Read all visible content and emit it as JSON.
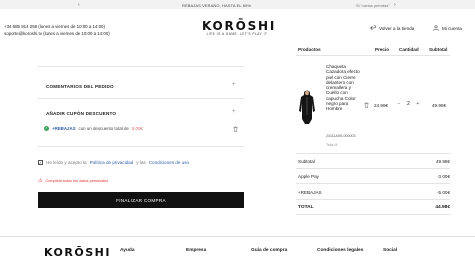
{
  "promo": {
    "prev_glyph": "‹",
    "next_glyph": "›",
    "main_text": "REBAJAS VERANO, HASTA EL 69%",
    "sub_text": "Si \"varias prendas\""
  },
  "header": {
    "phone_line": "+34 685 914 259 (lunes a viernes de 10:00 a 14:00)",
    "email_line": "soporte@koroshi.tv (lunes a viernes de 10:00 a 14:00)",
    "logo_name": "KORŌSHI",
    "logo_tagline": "LIFE IS A GAME. LET'S PLAY IT",
    "back_label": "Volver a la tienda",
    "account_label": "Mi cuenta"
  },
  "form": {
    "comments_label": "COMENTARIOS DEL PEDIDO",
    "coupon_label": "AÑADIR CUPÓN DESCUENTO",
    "coupon_code": "+REBAJAS",
    "coupon_text": "con un descuento total de",
    "coupon_amount": "5.00€",
    "privacy_prefix": "He leído y acepto la",
    "privacy_link": "Política de privacidad",
    "privacy_mid": "y las",
    "terms_link": "Condiciones de uso",
    "warning_text": "Completa todos tus datos personales",
    "submit_label": "FINALIZAR COMPRA"
  },
  "cart": {
    "columns": [
      "Productos",
      "Precio",
      "Cantidad",
      "Subtotal"
    ],
    "item": {
      "description": "Chaqueta Cazadora efecto piel con Cierre delantero con cremallera y Cuello con capucha Color negro para Hombre",
      "sku": "24111A0S-000003",
      "size": "Talla M",
      "price": "24.99€",
      "quantity": "2",
      "qty_minus": "−",
      "qty_plus": "+",
      "subtotal": "49.98€"
    },
    "summary": [
      {
        "label": "Subtotal",
        "value": "49.98€"
      },
      {
        "label": "Apple Pay",
        "value": "0.00€"
      },
      {
        "label": "+REBAJAS",
        "value": "-5.00€"
      },
      {
        "label": "TOTAL",
        "value": "44.98€"
      }
    ]
  },
  "footer": {
    "logo_name": "KORŌSHI",
    "columns": [
      "Ayuda",
      "Empresa",
      "Guía de compra",
      "Condiciones legales",
      "Social"
    ]
  },
  "colors": {
    "accent_link": "#3060a8",
    "success": "#3aa45c",
    "error": "#dd3333",
    "button": "#111111"
  }
}
